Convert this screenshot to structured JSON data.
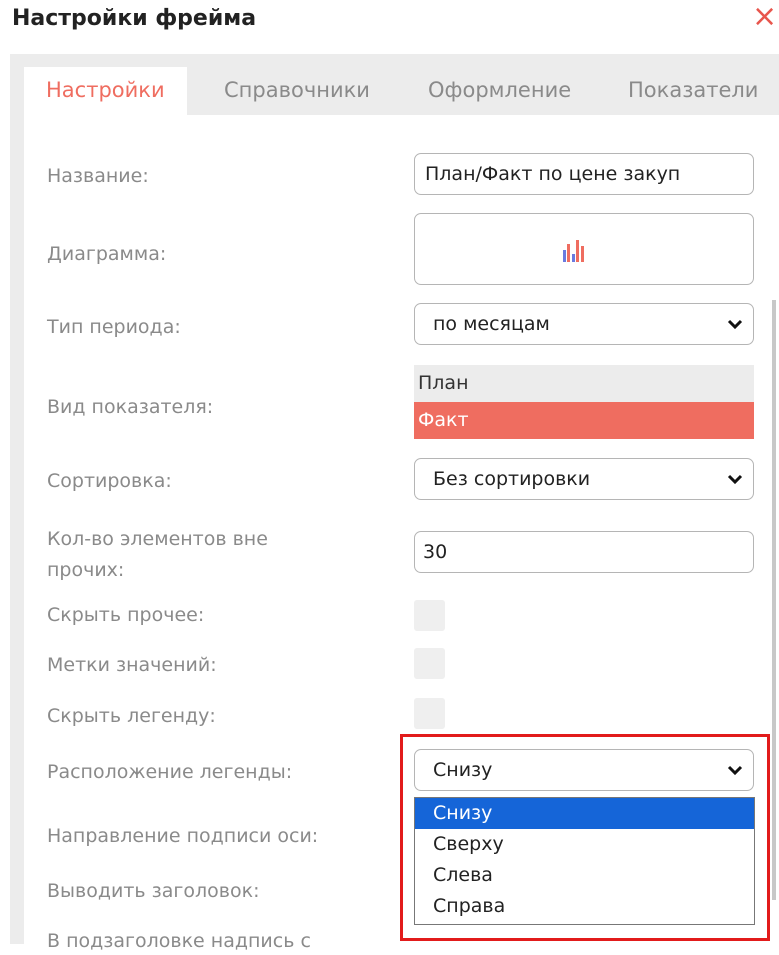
{
  "header": {
    "title": "Настройки фрейма",
    "close_glyph": "×"
  },
  "tabs": [
    {
      "label": "Настройки",
      "active": true
    },
    {
      "label": "Справочники",
      "active": false
    },
    {
      "label": "Оформление",
      "active": false
    },
    {
      "label": "Показатели",
      "active": false
    }
  ],
  "fields": {
    "name": {
      "label": "Название:",
      "value": "План/Факт по цене закуп"
    },
    "chart": {
      "label": "Диаграмма:",
      "icon": "bar-chart-icon"
    },
    "period_type": {
      "label": "Тип периода:",
      "value": "по месяцам"
    },
    "indicator_type": {
      "label": "Вид показателя:",
      "options": [
        {
          "label": "План",
          "selected": false
        },
        {
          "label": "Факт",
          "selected": true
        }
      ]
    },
    "sorting": {
      "label": "Сортировка:",
      "value": "Без сортировки"
    },
    "count_outside_other": {
      "label_line1": "Кол-во элементов вне",
      "label_line2": "прочих:",
      "value": "30"
    },
    "hide_other": {
      "label": "Скрыть прочее:"
    },
    "value_labels": {
      "label": "Метки значений:"
    },
    "hide_legend": {
      "label": "Скрыть легенду:"
    },
    "legend_position": {
      "label": "Расположение легенды:",
      "value": "Снизу",
      "options": [
        "Снизу",
        "Сверху",
        "Слева",
        "Справа"
      ],
      "highlighted": "Снизу"
    },
    "axis_label_direction": {
      "label": "Направление подписи оси:"
    },
    "show_title": {
      "label": "Выводить заголовок:"
    },
    "subtitle_caption": {
      "label": "В подзаголовке надпись с"
    }
  },
  "colors": {
    "accent": "#ef6d60",
    "selection_blue": "#1565d8",
    "highlight_red": "#e21b1b",
    "label_gray": "#8a8a8a"
  }
}
